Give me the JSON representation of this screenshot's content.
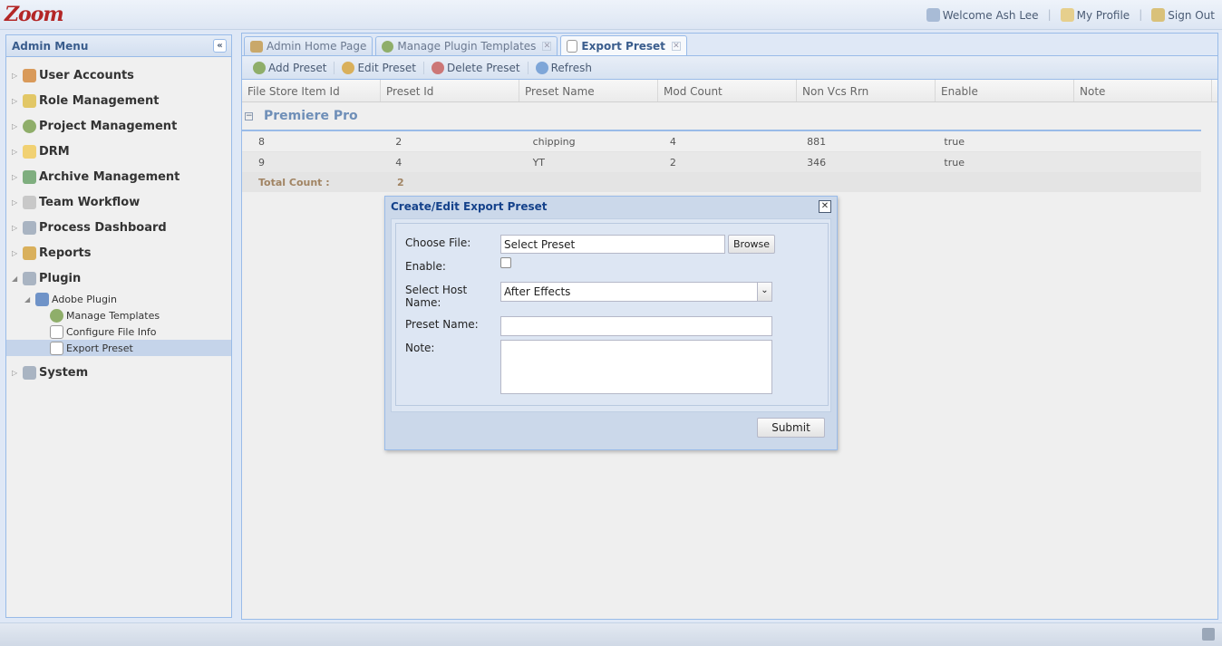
{
  "app": {
    "logo": "Zoom",
    "user_links": [
      {
        "label": "Welcome Ash Lee",
        "icon": "user-icon"
      },
      {
        "label": "My Profile",
        "icon": "profile-icon"
      },
      {
        "label": "Sign Out",
        "icon": "lock-icon"
      }
    ]
  },
  "sidebar": {
    "title": "Admin Menu",
    "items": [
      {
        "label": "User Accounts",
        "icon": "user-icon",
        "arrow": "▷"
      },
      {
        "label": "Role Management",
        "icon": "shield-icon",
        "arrow": "▷"
      },
      {
        "label": "Project Management",
        "icon": "pie-chart-icon",
        "arrow": "▷"
      },
      {
        "label": "DRM",
        "icon": "folder-icon",
        "arrow": "▷"
      },
      {
        "label": "Archive Management",
        "icon": "archive-icon",
        "arrow": "▷"
      },
      {
        "label": "Team Workflow",
        "icon": "box-icon",
        "arrow": "▷"
      },
      {
        "label": "Process Dashboard",
        "icon": "monitor-icon",
        "arrow": "▷"
      },
      {
        "label": "Reports",
        "icon": "report-icon",
        "arrow": "▷"
      },
      {
        "label": "Plugin",
        "icon": "monitor-icon",
        "arrow": "◢"
      },
      {
        "label": "Adobe Plugin",
        "icon": "desktop-icon",
        "arrow": "◢"
      },
      {
        "label": "Manage Templates",
        "icon": "pie-chart-icon"
      },
      {
        "label": "Configure File Info",
        "icon": "document-icon"
      },
      {
        "label": "Export Preset",
        "icon": "document-icon"
      },
      {
        "label": "System",
        "icon": "monitor-icon",
        "arrow": "▷"
      }
    ]
  },
  "tabs": [
    {
      "label": "Admin Home Page",
      "icon": "home-icon"
    },
    {
      "label": "Manage Plugin Templates",
      "icon": "pie-chart-icon"
    },
    {
      "label": "Export Preset",
      "icon": "document-icon"
    }
  ],
  "toolbar": {
    "add": "Add Preset",
    "edit": "Edit Preset",
    "delete": "Delete Preset",
    "refresh": "Refresh"
  },
  "grid": {
    "columns": [
      "File Store Item Id",
      "Preset Id",
      "Preset Name",
      "Mod Count",
      "Non Vcs Rrn",
      "Enable",
      "Note"
    ],
    "group": "Premiere Pro",
    "group_toggle": "−",
    "rows": [
      [
        "8",
        "2",
        "chipping",
        "4",
        "881",
        "true",
        ""
      ],
      [
        "9",
        "4",
        "YT",
        "2",
        "346",
        "true",
        ""
      ]
    ],
    "total_label": "Total Count :",
    "total_value": "2"
  },
  "dialog": {
    "title": "Create/Edit Export Preset",
    "close": "✕",
    "choose_file_label": "Choose File:",
    "choose_file_value": "Select Preset",
    "browse_label": "Browse",
    "enable_label": "Enable:",
    "host_label_line1": "Select Host",
    "host_label_line2": "Name:",
    "host_value": "After Effects",
    "host_arrow": "⌄",
    "preset_name_label": "Preset Name:",
    "preset_name_value": "",
    "note_label": "Note:",
    "note_value": "",
    "submit_label": "Submit"
  },
  "colors": {
    "accent": "#99bbe8",
    "header_text": "#15428b",
    "logo": "#b32626"
  }
}
